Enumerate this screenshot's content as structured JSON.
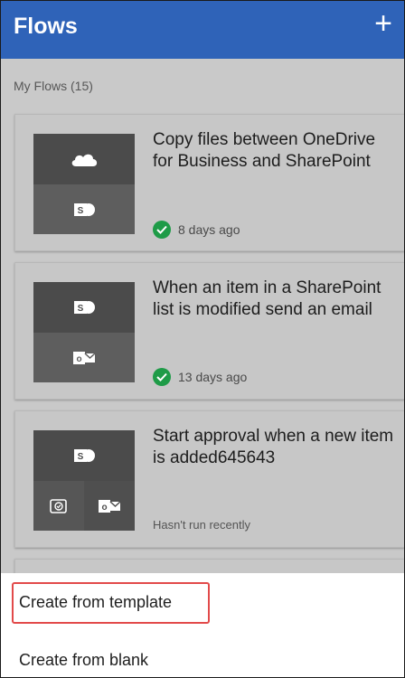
{
  "header": {
    "title": "Flows",
    "add_symbol": "+"
  },
  "section": {
    "label": "My Flows (15)"
  },
  "flows": [
    {
      "title": "Copy files between OneDrive for Business and SharePoint",
      "status": "8 days ago",
      "icons": [
        "onedrive-icon",
        "sharepoint-icon"
      ]
    },
    {
      "title": "When an item in a SharePoint list is modified send an email",
      "status": "13 days ago",
      "icons": [
        "sharepoint-icon",
        "outlook-icon"
      ]
    },
    {
      "title": "Start approval when a new item is added645643",
      "status": "Hasn't run recently",
      "icons": [
        "sharepoint-icon",
        "approval-icon",
        "outlook-icon"
      ]
    }
  ],
  "menu": {
    "create_from_template": "Create from template",
    "create_from_blank": "Create from blank"
  },
  "colors": {
    "header": "#2f63b8",
    "success": "#1e9b47",
    "highlight": "#e24a4a"
  }
}
